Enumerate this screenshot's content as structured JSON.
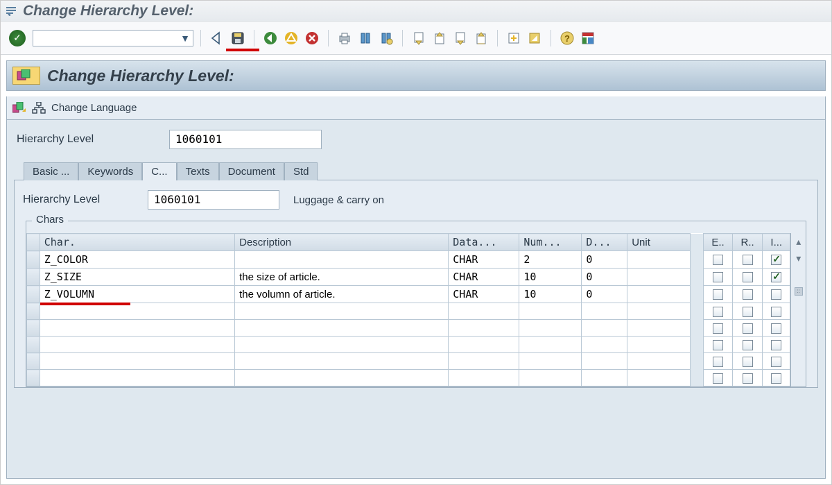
{
  "window": {
    "title": "Change Hierarchy Level:"
  },
  "page": {
    "title": "Change Hierarchy Level:"
  },
  "subtoolbar": {
    "change_language_label": "Change Language"
  },
  "form": {
    "hierarchy_label": "Hierarchy Level",
    "hierarchy_value": "1060101"
  },
  "tabs": [
    {
      "label": "Basic ..."
    },
    {
      "label": "Keywords"
    },
    {
      "label": "C..."
    },
    {
      "label": "Texts"
    },
    {
      "label": "Document"
    },
    {
      "label": "Std"
    }
  ],
  "panel": {
    "hierarchy_label": "Hierarchy Level",
    "hierarchy_value": "1060101",
    "hierarchy_desc": "Luggage & carry on"
  },
  "chars": {
    "box_title": "Chars",
    "columns": {
      "char": "Char.",
      "desc": "Description",
      "data": "Data...",
      "num": "Num...",
      "d": "D...",
      "unit": "Unit",
      "e": "E..",
      "r": "R..",
      "i": "I..."
    },
    "rows": [
      {
        "char": "Z_COLOR",
        "desc": "",
        "data": "CHAR",
        "num": "2",
        "d": "0",
        "unit": "",
        "e": false,
        "r": false,
        "i": true
      },
      {
        "char": "Z_SIZE",
        "desc": "the size of article.",
        "data": "CHAR",
        "num": "10",
        "d": "0",
        "unit": "",
        "e": false,
        "r": false,
        "i": true
      },
      {
        "char": "Z_VOLUMN",
        "desc": "the volumn of article.",
        "data": "CHAR",
        "num": "10",
        "d": "0",
        "unit": "",
        "e": false,
        "r": false,
        "i": false
      }
    ]
  }
}
